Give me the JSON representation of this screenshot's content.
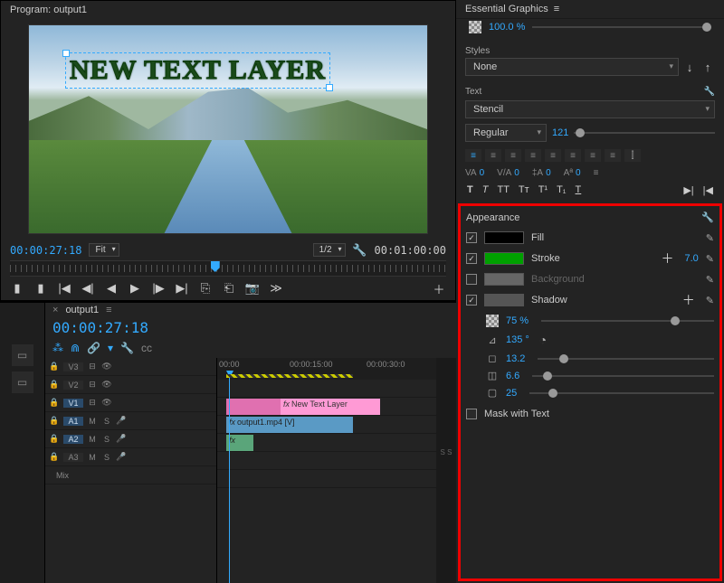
{
  "program": {
    "title": "Program: output1",
    "text_overlay": "NEW TEXT LAYER",
    "current_tc": "00:00:27:18",
    "fit_label": "Fit",
    "scale_label": "1/2",
    "duration_tc": "00:01:00:00"
  },
  "timeline": {
    "tab_label": "output1",
    "current_tc": "00:00:27:18",
    "ruler": {
      "t0": "00:00",
      "t1": "00:00:15:00",
      "t2": "00:00:30:0"
    },
    "tracks": {
      "v3": "V3",
      "v2": "V2",
      "v1": "V1",
      "a1": "A1",
      "a2": "A2",
      "a3": "A3",
      "mix": "Mix"
    },
    "clips": {
      "text_layer": "New Text Layer",
      "video": "output1.mp4 [V]",
      "fx_label": "fx"
    },
    "audio_letters": {
      "m": "M",
      "s": "S"
    },
    "audio_meter": "S S"
  },
  "graphics": {
    "panel_title": "Essential Graphics",
    "opacity": "100.0 %",
    "styles_label": "Styles",
    "style_value": "None",
    "text_label": "Text",
    "font": "Stencil",
    "weight": "Regular",
    "size": "121",
    "metrics": {
      "kerning_label": "VA",
      "kerning": "0",
      "tracking": "0",
      "leading": "0",
      "baseline": "0"
    },
    "typo": {
      "bold": "T",
      "italic": "T",
      "caps1": "TT",
      "caps2": "Tт",
      "super": "T¹",
      "sub": "T₁",
      "under": "T"
    }
  },
  "appearance": {
    "title": "Appearance",
    "fill_label": "Fill",
    "stroke_label": "Stroke",
    "stroke_value": "7.0",
    "background_label": "Background",
    "shadow_label": "Shadow",
    "shadow": {
      "opacity": "75 %",
      "angle": "135 °",
      "distance": "13.2",
      "size": "6.6",
      "blur": "25"
    },
    "mask_label": "Mask with Text",
    "colors": {
      "fill": "#000000",
      "stroke": "#00a000",
      "background": "#666666",
      "shadow": "#555555"
    }
  }
}
